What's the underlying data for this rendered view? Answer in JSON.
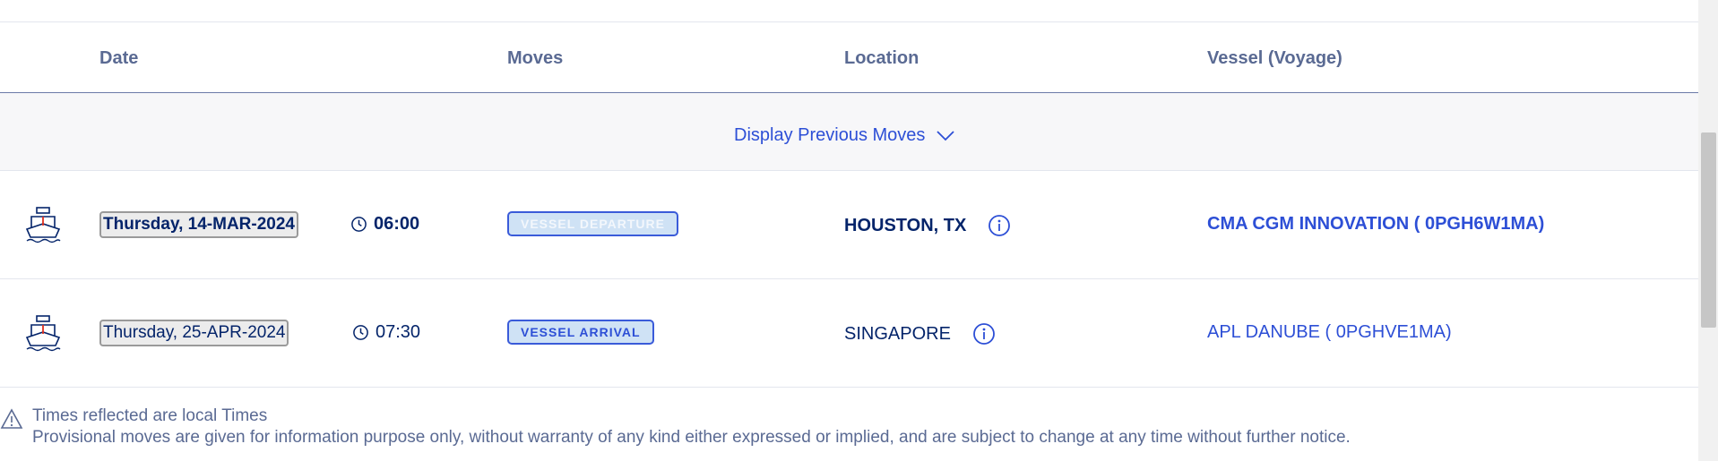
{
  "table": {
    "columns": {
      "date": "Date",
      "moves": "Moves",
      "location": "Location",
      "vessel": "Vessel (Voyage)"
    },
    "display_previous_moves": "Display Previous Moves",
    "rows": [
      {
        "icon": "ship-icon",
        "date": "Thursday, 14-MAR-2024",
        "time": "06:00",
        "move": "VESSEL DEPARTURE",
        "location": "HOUSTON, TX",
        "vessel": "CMA CGM INNOVATION ( 0PGH6W1MA)",
        "emphasis": "bold"
      },
      {
        "icon": "ship-icon",
        "date": "Thursday, 25-APR-2024",
        "time": "07:30",
        "move": "VESSEL ARRIVAL",
        "location": "SINGAPORE",
        "vessel": "APL DANUBE ( 0PGHVE1MA)",
        "emphasis": "normal"
      }
    ]
  },
  "notes": {
    "line1": "Times reflected are local Times",
    "line2": "Provisional moves are given for information purpose only, without warranty of any kind either expressed or implied, and are subject to change at any time without further notice."
  },
  "colors": {
    "navy_text": "#04246a",
    "link_blue": "#2d4fd6",
    "header_gray": "#5a6a93",
    "badge_bg": "#cfe2f5",
    "band_bg": "#f7f7f9"
  }
}
